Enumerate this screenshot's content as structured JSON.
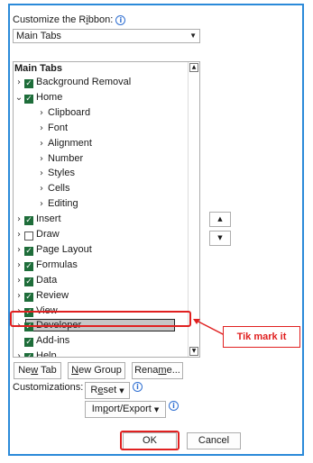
{
  "dialog": {
    "customize_label_pre": "Customize the R",
    "customize_label_u": "i",
    "customize_label_post": "bbon:",
    "tabs_dropdown": {
      "value": "Main Tabs"
    },
    "tree": {
      "header": "Main Tabs",
      "items": [
        {
          "label": "Background Removal",
          "chevron": "right",
          "checked": true,
          "level": 0
        },
        {
          "label": "Home",
          "chevron": "down",
          "checked": true,
          "level": 0
        },
        {
          "label": "Clipboard",
          "chevron": "right",
          "checked": null,
          "level": 1
        },
        {
          "label": "Font",
          "chevron": "right",
          "checked": null,
          "level": 1
        },
        {
          "label": "Alignment",
          "chevron": "right",
          "checked": null,
          "level": 1
        },
        {
          "label": "Number",
          "chevron": "right",
          "checked": null,
          "level": 1
        },
        {
          "label": "Styles",
          "chevron": "right",
          "checked": null,
          "level": 1
        },
        {
          "label": "Cells",
          "chevron": "right",
          "checked": null,
          "level": 1
        },
        {
          "label": "Editing",
          "chevron": "right",
          "checked": null,
          "level": 1
        },
        {
          "label": "Insert",
          "chevron": "right",
          "checked": true,
          "level": 0
        },
        {
          "label": "Draw",
          "chevron": "right",
          "checked": false,
          "level": 0
        },
        {
          "label": "Page Layout",
          "chevron": "right",
          "checked": true,
          "level": 0
        },
        {
          "label": "Formulas",
          "chevron": "right",
          "checked": true,
          "level": 0
        },
        {
          "label": "Data",
          "chevron": "right",
          "checked": true,
          "level": 0
        },
        {
          "label": "Review",
          "chevron": "right",
          "checked": true,
          "level": 0
        },
        {
          "label": "View",
          "chevron": "right",
          "checked": true,
          "level": 0
        },
        {
          "label": "Developer",
          "chevron": "right",
          "checked": true,
          "level": 0,
          "selected": true
        },
        {
          "label": "Add-ins",
          "chevron": "none",
          "checked": true,
          "level": 0
        },
        {
          "label": "Help",
          "chevron": "right",
          "checked": true,
          "level": 0
        }
      ]
    },
    "buttons": {
      "new_tab_pre": "Ne",
      "new_tab_u": "w",
      "new_tab_post": " Tab",
      "new_group_pre": "",
      "new_group_u": "N",
      "new_group_post": "ew Group",
      "rename_pre": "Rena",
      "rename_u": "m",
      "rename_post": "e...",
      "customizations_label": "Customizations:",
      "reset_pre": "R",
      "reset_u": "e",
      "reset_post": "set",
      "import_export_pre": "Im",
      "import_export_u": "p",
      "import_export_post": "ort/Export",
      "ok": "OK",
      "cancel": "Cancel"
    },
    "annotation": {
      "callout": "Tik mark it"
    },
    "colors": {
      "highlight": "#e02020",
      "checkbox": "#1e6d3a",
      "frame": "#2b8ad9"
    }
  }
}
